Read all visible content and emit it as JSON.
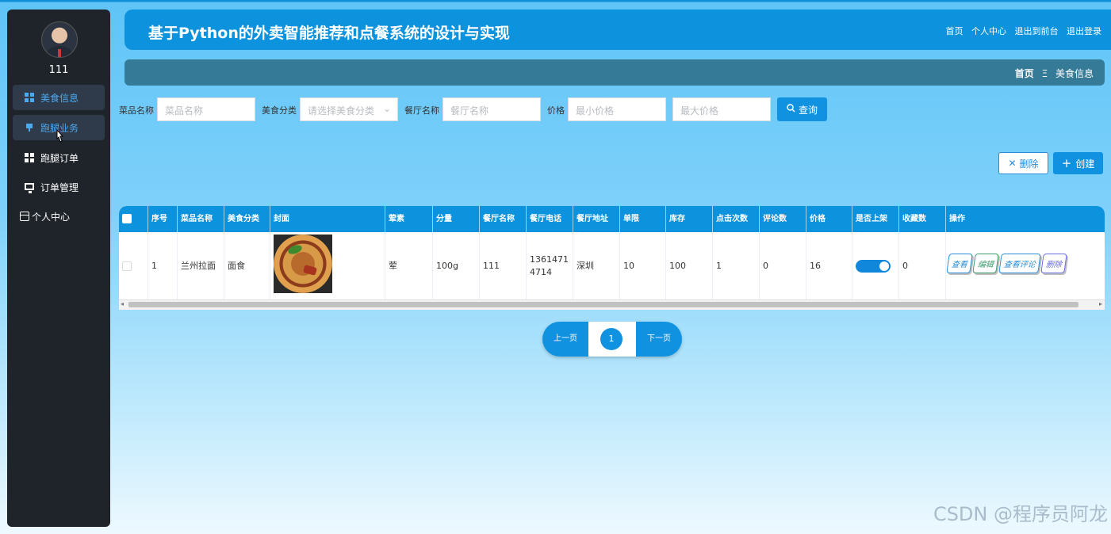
{
  "sidebar": {
    "username": "111",
    "items": [
      {
        "label": "美食信息",
        "icon": "grid-icon"
      },
      {
        "label": "跑腿业务",
        "icon": "pin-icon"
      },
      {
        "label": "跑腿订单",
        "icon": "grid-icon"
      },
      {
        "label": "订单管理",
        "icon": "monitor-icon"
      },
      {
        "label": "个人中心",
        "icon": "card-icon"
      }
    ]
  },
  "header": {
    "title": "基于Python的外卖智能推荐和点餐系统的设计与实现",
    "links": [
      "首页",
      "个人中心",
      "退出到前台",
      "退出登录"
    ]
  },
  "breadcrumb": {
    "home": "首页",
    "separator": "Ξ",
    "current": "美食信息"
  },
  "search": {
    "name_label": "菜品名称",
    "name_placeholder": "菜品名称",
    "category_label": "美食分类",
    "category_placeholder": "请选择美食分类",
    "restaurant_label": "餐厅名称",
    "restaurant_placeholder": "餐厅名称",
    "price_label": "价格",
    "min_price_placeholder": "最小价格",
    "max_price_placeholder": "最大价格",
    "query_button": "查询"
  },
  "actions": {
    "delete": "删除",
    "create": "创建"
  },
  "table": {
    "headers": [
      "序号",
      "菜品名称",
      "美食分类",
      "封面",
      "荤素",
      "分量",
      "餐厅名称",
      "餐厅电话",
      "餐厅地址",
      "单限",
      "库存",
      "点击次数",
      "评论数",
      "价格",
      "是否上架",
      "收藏数",
      "操作"
    ],
    "rows": [
      {
        "index": "1",
        "name": "兰州拉面",
        "category": "面食",
        "type": "荤",
        "portion": "100g",
        "restaurant": "111",
        "phone": "13614714714",
        "address": "深圳",
        "limit": "10",
        "stock": "100",
        "clicks": "1",
        "comments": "0",
        "price": "16",
        "on_shelf": true,
        "favorites": "0"
      }
    ],
    "ops": [
      "查看",
      "编辑",
      "查看评论",
      "删除"
    ]
  },
  "pager": {
    "prev": "上一页",
    "current": "1",
    "next": "下一页"
  },
  "watermark": "CSDN @程序员阿龙"
}
